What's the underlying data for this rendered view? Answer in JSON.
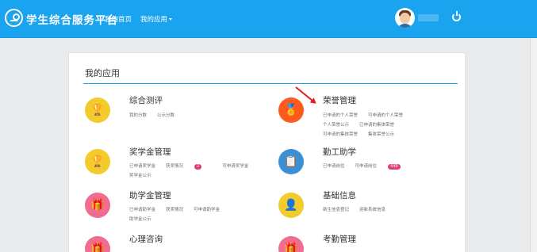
{
  "header": {
    "brand": "学生综合服务平台",
    "nav": [
      {
        "label": "我的首页"
      },
      {
        "label": "我的应用"
      }
    ]
  },
  "main": {
    "title": "我的应用",
    "apps": [
      {
        "name": "综合测评",
        "icon": "trophy-icon",
        "color": "#f3cb2c",
        "rows": [
          [
            "我的分数",
            "公示分数"
          ]
        ]
      },
      {
        "name": "荣誉管理",
        "icon": "award-podium-icon",
        "color": "#ff5a1d",
        "rows": [
          [
            "已申请的个人荣誉",
            "可申请的个人荣誉"
          ],
          [
            "个人荣誉公示",
            "已申请的集体荣誉"
          ],
          [
            "可申请的集体荣誉",
            "集体荣誉公示"
          ]
        ]
      },
      {
        "name": "奖学金管理",
        "icon": "trophy-icon",
        "color": "#f3cb2c",
        "rows": [
          [
            "已申请奖学金",
            "获奖情况",
            "可申请奖学金"
          ],
          [
            "奖学金公示"
          ]
        ],
        "badge": "2"
      },
      {
        "name": "勤工助学",
        "icon": "clipboard-icon",
        "color": "#3b8fd7",
        "rows": [
          [
            "已申请岗位",
            "可申请岗位"
          ]
        ],
        "badge": "449"
      },
      {
        "name": "助学金管理",
        "icon": "gift-icon",
        "color": "#f06d8f",
        "rows": [
          [
            "已申请助学金",
            "获奖情况",
            "可申请助学金"
          ],
          [
            "助学金公示"
          ]
        ]
      },
      {
        "name": "基础信息",
        "icon": "user-icon",
        "color": "#f3cb2c",
        "rows": [
          [
            "新生信息登记",
            "迎新系统信息"
          ]
        ]
      },
      {
        "name": "心理咨询",
        "icon": "gift-icon",
        "color": "#f06d8f",
        "rows": []
      },
      {
        "name": "考勤管理",
        "icon": "gift-icon",
        "color": "#f06d8f",
        "rows": []
      }
    ]
  }
}
